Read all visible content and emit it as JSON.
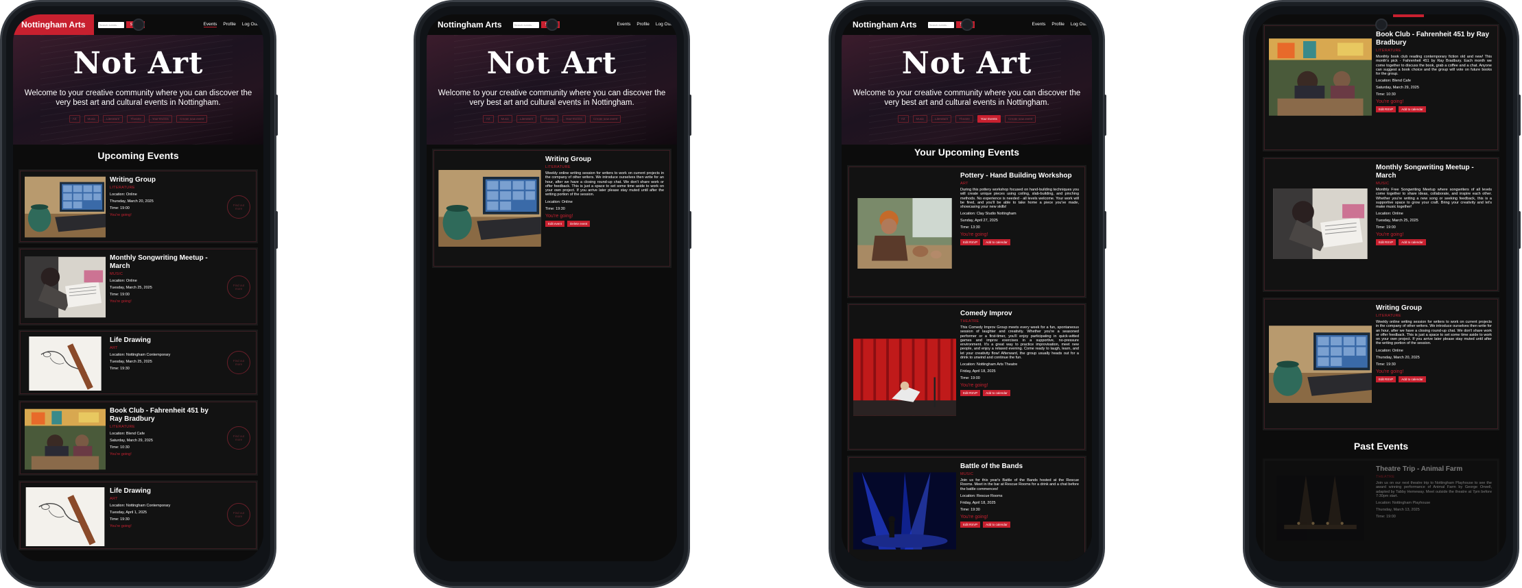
{
  "brand": "Nottingham Arts",
  "search_placeholder": "Search events...",
  "search_btn": "Search",
  "nav": {
    "events": "Events",
    "profile": "Profile",
    "logout": "Log Out"
  },
  "hero": {
    "title": "Not Art",
    "subtitle": "Welcome to your creative community where you can discover the very best art and cultural events in Nottingham."
  },
  "filters": [
    "Art",
    "Music",
    "Literature",
    "Theatre",
    "Your Events",
    "Create new event"
  ],
  "screens": {
    "s1": {
      "section": "Upcoming Events",
      "circle": "Find out more",
      "cards": [
        {
          "title": "Writing Group",
          "cat": "LITERATURE",
          "loc": "Location: Online",
          "date": "Thursday, March 20, 2025",
          "time": "Time: 19:00",
          "going": "You're going!"
        },
        {
          "title": "Monthly Songwriting Meetup - March",
          "cat": "MUSIC",
          "loc": "Location: Online",
          "date": "Tuesday, March 25, 2025",
          "time": "Time: 19:00",
          "going": "You're going!"
        },
        {
          "title": "Life Drawing",
          "cat": "ART",
          "loc": "Location: Nottingham Contemporary",
          "date": "Tuesday, March 25, 2025",
          "time": "Time: 19:30",
          "going": ""
        },
        {
          "title": "Book Club - Fahrenheit 451 by Ray Bradbury",
          "cat": "LITERATURE",
          "loc": "Location: Blend Cafe",
          "date": "Saturday, March 29, 2025",
          "time": "Time: 10:30",
          "going": "You're going!"
        },
        {
          "title": "Life Drawing",
          "cat": "ART",
          "loc": "Location: Nottingham Contemporary",
          "date": "Tuesday, April 1, 2025",
          "time": "Time: 19:30",
          "going": "You're going!"
        }
      ]
    },
    "s2": {
      "card": {
        "title": "Writing Group",
        "cat": "LITERATURE",
        "desc": "Weekly online writing session for writers to work on current projects in the company of other writers. We introduce ourselves then write for an hour, after we have a closing round-up chat. We don't share work or offer feedback. This is just a space to set some time aside to work on your own project. If you arrive later please stay muted until after the writing portion of the session.",
        "loc": "Location: Online",
        "time": "Time: 19:30",
        "going": "You're going!",
        "b1": "Edit event",
        "b2": "Delete event"
      }
    },
    "s3": {
      "section": "Your Upcoming Events",
      "cards": [
        {
          "title": "Pottery - Hand Building Workshop",
          "cat": "ART",
          "desc": "During this pottery workshop focused on hand-building techniques you will create unique pieces using coiling, slab-building, and pinching methods. No experience is needed - all levels welcome. Your work will be fired, and you'll be able to take home a piece you've made, showcasing your new skills!",
          "loc": "Location: Clay Studio Nottingham",
          "date": "Sunday, April 27, 2025",
          "time": "Time: 13:30",
          "going": "You're going!",
          "b1": "Edit RSVP",
          "b2": "Add to calendar"
        },
        {
          "title": "Comedy Improv",
          "cat": "THEATRE",
          "desc": "This Comedy Improv Group meets every week for a fun, spontaneous session of laughter and creativity. Whether you're a seasoned performer or a first-timer, you'll enjoy participating in quick-witted games and improv exercises in a supportive, no-pressure environment. It's a great way to practice improvisation, meet new people, and enjoy a relaxed evening. Come ready to laugh, learn, and let your creativity flow! Afterward, the group usually heads out for a drink to unwind and continue the fun.",
          "loc": "Location: Nottingham Arts Theatre",
          "date": "Friday, April 18, 2025",
          "time": "Time: 19:00",
          "going": "You're going!",
          "b1": "Edit RSVP",
          "b2": "Add to calendar"
        },
        {
          "title": "Battle of the Bands",
          "cat": "MUSIC",
          "desc": "Join us for this year's Battle of the Bands hosted at the Rescue Rooms. Meet in the bar at Rescue Rooms for a drink and a chat before the battle commences!",
          "loc": "Location: Rescue Rooms",
          "date": "Friday, April 18, 2025",
          "time": "Time: 19:30",
          "going": "You're going!",
          "b1": "Edit RSVP",
          "b2": "Add to calendar"
        }
      ]
    },
    "s4": {
      "cards": [
        {
          "title": "Book Club - Fahrenheit 451 by Ray Bradbury",
          "cat": "LITERATURE",
          "desc": "Monthly book club reading contemporary fiction old and new! This month's pick - Fahrenheit 451 by Ray Bradbury. Each month we come together to discuss the book, grab a coffee and a chat. Anyone can suggest a book choice and the group will vote on future books for the group.",
          "loc": "Location: Blend Cafe",
          "date": "Saturday, March 29, 2025",
          "time": "Time: 10:30",
          "going": "You're going!",
          "b1": "Edit RSVP",
          "b2": "Add to calendar"
        },
        {
          "title": "Monthly Songwriting Meetup - March",
          "cat": "MUSIC",
          "desc": "Monthly Free Songwriting Meetup where songwriters of all levels come together to share ideas, collaborate, and inspire each other. Whether you're writing a new song or seeking feedback, this is a supportive space to grow your craft. Bring your creativity and let's make music together!",
          "loc": "Location: Online",
          "date": "Tuesday, March 25, 2025",
          "time": "Time: 19:00",
          "going": "You're going!",
          "b1": "Edit RSVP",
          "b2": "Add to calendar"
        },
        {
          "title": "Writing Group",
          "cat": "LITERATURE",
          "desc": "Weekly online writing session for writers to work on current projects in the company of other writers. We introduce ourselves then write for an hour, after we have a closing round-up chat. We don't share work or offer feedback. This is just a space to set some time aside to work on your own project. If you arrive later please stay muted until after the writing portion of the session.",
          "loc": "Location: Online",
          "date": "Thursday, March 20, 2025",
          "time": "Time: 19:30",
          "going": "You're going!",
          "b1": "Edit RSVP",
          "b2": "Add to calendar"
        }
      ],
      "past_title": "Past Events",
      "past": {
        "title": "Theatre Trip - Animal Farm",
        "cat": "THEATRE",
        "desc": "Join us on our next theatre trip to Nottingham Playhouse to see the award winning performance of Animal Farm by George Orwell, adapted by Tabby Hemeway. Meet outside the theatre at 7pm before 7:30pm start.",
        "loc": "Location: Nottingham Playhouse",
        "date": "Thursday, March 13, 2025",
        "time": "Time: 19:00"
      }
    }
  }
}
